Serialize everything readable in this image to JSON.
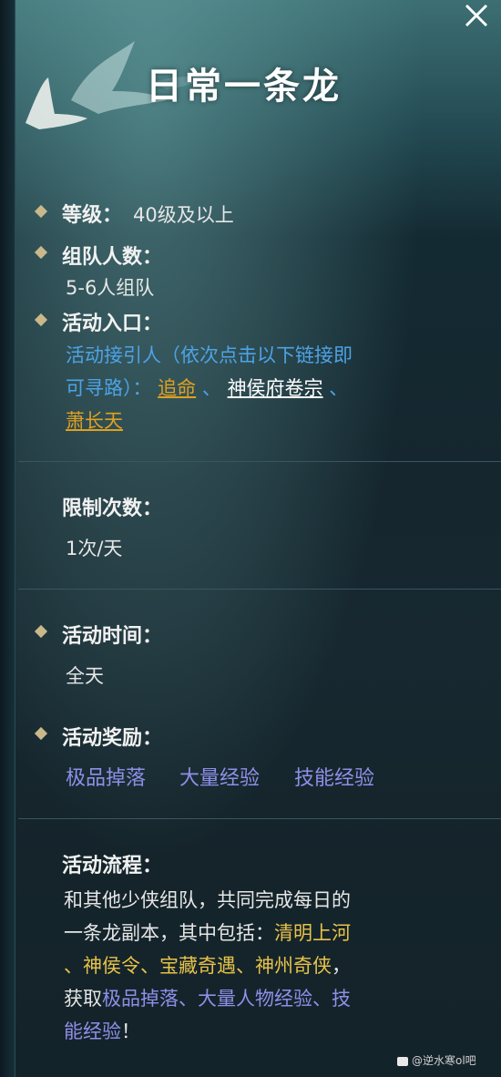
{
  "title": "日常一条龙",
  "close_label": "✕",
  "level": {
    "label": "等级：",
    "value": "40级及以上"
  },
  "team": {
    "label": "组队人数：",
    "value": "5-6人组队"
  },
  "entry": {
    "label": "活动入口：",
    "desc_line1": "活动接引人（依次点击以下链接即",
    "desc_line2": "可寻路）：",
    "links": [
      "追命",
      "神侯府卷宗",
      "萧长天"
    ],
    "sep1": "、",
    "sep2": "、"
  },
  "limit": {
    "label": "限制次数：",
    "value": "1次/天"
  },
  "time": {
    "label": "活动时间：",
    "value": "全天"
  },
  "reward": {
    "label": "活动奖励：",
    "items": [
      "极品掉落",
      "大量经验",
      "技能经验"
    ]
  },
  "flow": {
    "label": "活动流程：",
    "line1": "和其他少侠组队，共同完成每日的",
    "line2_a": "一条龙副本，其中包括：",
    "line2_b": "清明上河",
    "line3_a": "、",
    "line3_b": "神侯令",
    "line3_c": "、",
    "line3_d": "宝藏奇遇",
    "line3_e": "、",
    "line3_f": "神州奇侠",
    "line3_g": "，",
    "line4_a": "获取",
    "line4_b": "极品掉落、大量人物经验、技",
    "line5_a": "能经验",
    "line5_b": "！"
  },
  "watermark": "@逆水寒ol吧",
  "colors": {
    "accent_blue": "#4da3e6",
    "link_orange": "#e0a020",
    "gold": "#e8c24a",
    "purple": "#8f8fe8"
  }
}
